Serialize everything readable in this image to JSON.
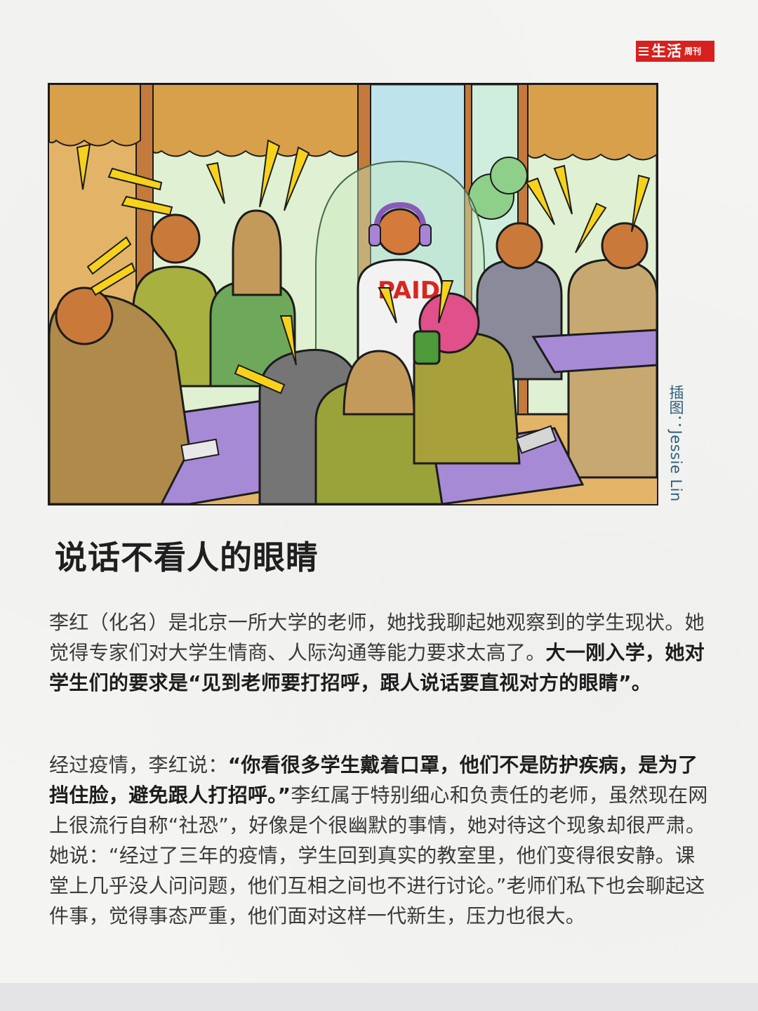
{
  "logo": {
    "text": "生活",
    "sub": "周刊"
  },
  "illustration": {
    "credit": "插图：Jessie Lin",
    "shirt_text": "PAID",
    "colors": {
      "window_frame": "#c47a3a",
      "awning": "#d8a04a",
      "sky": "#bfe3ea",
      "table_top": "#a68ad6",
      "skin": "#e0508a",
      "shirt_olive": "#9aa33a",
      "accent_yellow": "#f7d21a"
    }
  },
  "article": {
    "title": "说话不看人的眼睛",
    "p1_normal": "李红（化名）是北京一所大学的老师，她找我聊起她观察到的学生现状。她觉得专家们对大学生情商、人际沟通等能力要求太高了。",
    "p1_bold": "大一刚入学，她对学生们的要求是“见到老师要打招呼，跟人说话要直视对方的眼睛”。",
    "p2_start": "经过疫情，李红说：",
    "p2_bold": "“你看很多学生戴着口罩，他们不是防护疾病，是为了挡住脸，避免跟人打招呼。”",
    "p2_rest": "李红属于特别细心和负责任的老师，虽然现在网上很流行自称“社恐”，好像是个很幽默的事情，她对待这个现象却很严肃。她说：“经过了三年的疫情，学生回到真实的教室里，他们变得很安静。课堂上几乎没人问问题，他们互相之间也不进行讨论。”老师们私下也会聊起这件事，觉得事态严重，他们面对这样一代新生，压力也很大。"
  }
}
